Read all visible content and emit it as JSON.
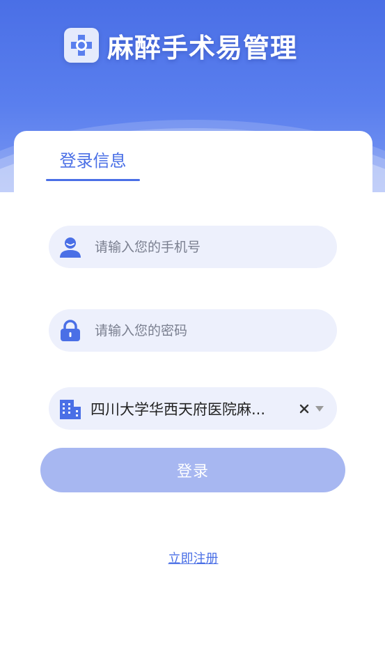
{
  "header": {
    "app_title": "麻醉手术易管理",
    "logo_icon": "medical-cross-icon"
  },
  "login": {
    "tab_label": "登录信息",
    "phone_placeholder": "请输入您的手机号",
    "password_placeholder": "请输入您的密码",
    "hospital_value": "四川大学华西天府医院麻...",
    "login_label": "登录",
    "register_label": "立即注册"
  },
  "colors": {
    "primary": "#4a6fe6",
    "field_bg": "#edf0fc",
    "button_disabled": "#a7b7f1"
  }
}
